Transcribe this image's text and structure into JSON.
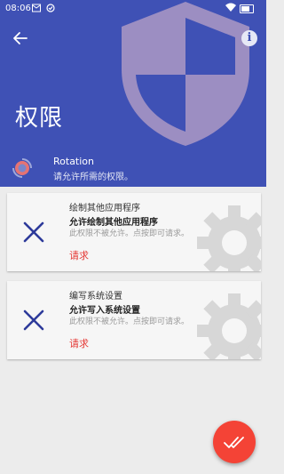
{
  "status_bar": {
    "time": "08:06"
  },
  "header": {
    "title": "权限"
  },
  "app": {
    "name": "Rotation",
    "description": "请允许所需的权限。"
  },
  "permissions": [
    {
      "name": "绘制其他应用程序",
      "label": "允许绘制其他应用程序",
      "status": "此权限不被允许。点按即可请求。",
      "action": "请求"
    },
    {
      "name": "编写系统设置",
      "label": "允许写入系统设置",
      "status": "此权限不被允许。点按即可请求。",
      "action": "请求"
    }
  ],
  "colors": {
    "primary": "#3f51b5",
    "accent": "#f44336",
    "deny": "#2d3a9a"
  },
  "icons": {
    "back": "arrow-left",
    "info": "info-circle",
    "fab": "double-check"
  }
}
